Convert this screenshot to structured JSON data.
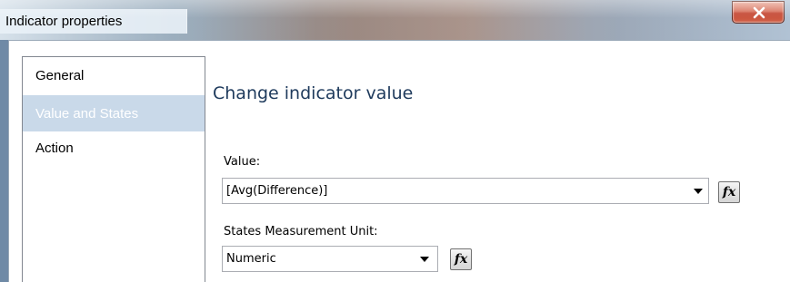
{
  "window": {
    "title": "Indicator properties",
    "close_glyph": "✕"
  },
  "nav": {
    "items": [
      {
        "label": "General",
        "selected": false
      },
      {
        "label": "Value and States",
        "selected": true
      },
      {
        "label": "Action",
        "selected": false
      }
    ]
  },
  "main": {
    "section_title": "Change indicator value",
    "value_field": {
      "label": "Value:",
      "value": "[Avg(Difference)]",
      "fx_label": "fx"
    },
    "states_unit_field": {
      "label": "States Measurement Unit:",
      "value": "Numeric",
      "fx_label": "fx"
    }
  },
  "colors": {
    "selected_nav_bg": "#c9d9e9",
    "section_title": "#1e3a5c",
    "close_button": "#c44632"
  }
}
